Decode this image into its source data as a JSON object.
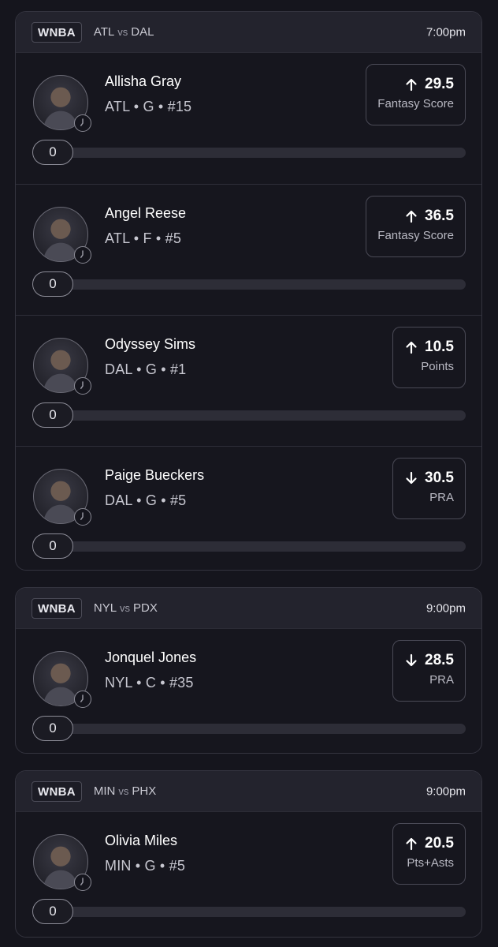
{
  "games": [
    {
      "league": "WNBA",
      "team_a": "ATL",
      "vs": "vs",
      "team_b": "DAL",
      "time": "7:00pm",
      "players": [
        {
          "name": "Allisha Gray",
          "meta": "ATL • G • #15",
          "direction": "up",
          "value": "29.5",
          "stat": "Fantasy Score",
          "progress_label": "0",
          "progress": 0
        },
        {
          "name": "Angel Reese",
          "meta": "ATL • F • #5",
          "direction": "up",
          "value": "36.5",
          "stat": "Fantasy Score",
          "progress_label": "0",
          "progress": 0
        },
        {
          "name": "Odyssey Sims",
          "meta": "DAL • G • #1",
          "direction": "up",
          "value": "10.5",
          "stat": "Points",
          "progress_label": "0",
          "progress": 0
        },
        {
          "name": "Paige Bueckers",
          "meta": "DAL • G • #5",
          "direction": "down",
          "value": "30.5",
          "stat": "PRA",
          "progress_label": "0",
          "progress": 0
        }
      ]
    },
    {
      "league": "WNBA",
      "team_a": "NYL",
      "vs": "vs",
      "team_b": "PDX",
      "time": "9:00pm",
      "players": [
        {
          "name": "Jonquel Jones",
          "meta": "NYL • C • #35",
          "direction": "down",
          "value": "28.5",
          "stat": "PRA",
          "progress_label": "0",
          "progress": 0
        }
      ]
    },
    {
      "league": "WNBA",
      "team_a": "MIN",
      "vs": "vs",
      "team_b": "PHX",
      "time": "9:00pm",
      "players": [
        {
          "name": "Olivia Miles",
          "meta": "MIN • G • #5",
          "direction": "up",
          "value": "20.5",
          "stat": "Pts+Asts",
          "progress_label": "0",
          "progress": 0
        }
      ]
    }
  ],
  "icons": {
    "up": "arrow-up-icon",
    "down": "arrow-down-icon",
    "clock": "clock-icon",
    "avatar": "player-avatar"
  },
  "colors": {
    "background": "#15151d",
    "card_header": "#23232d",
    "border": "#34343f",
    "text_primary": "#ffffff",
    "text_secondary": "#c7c7d0"
  }
}
